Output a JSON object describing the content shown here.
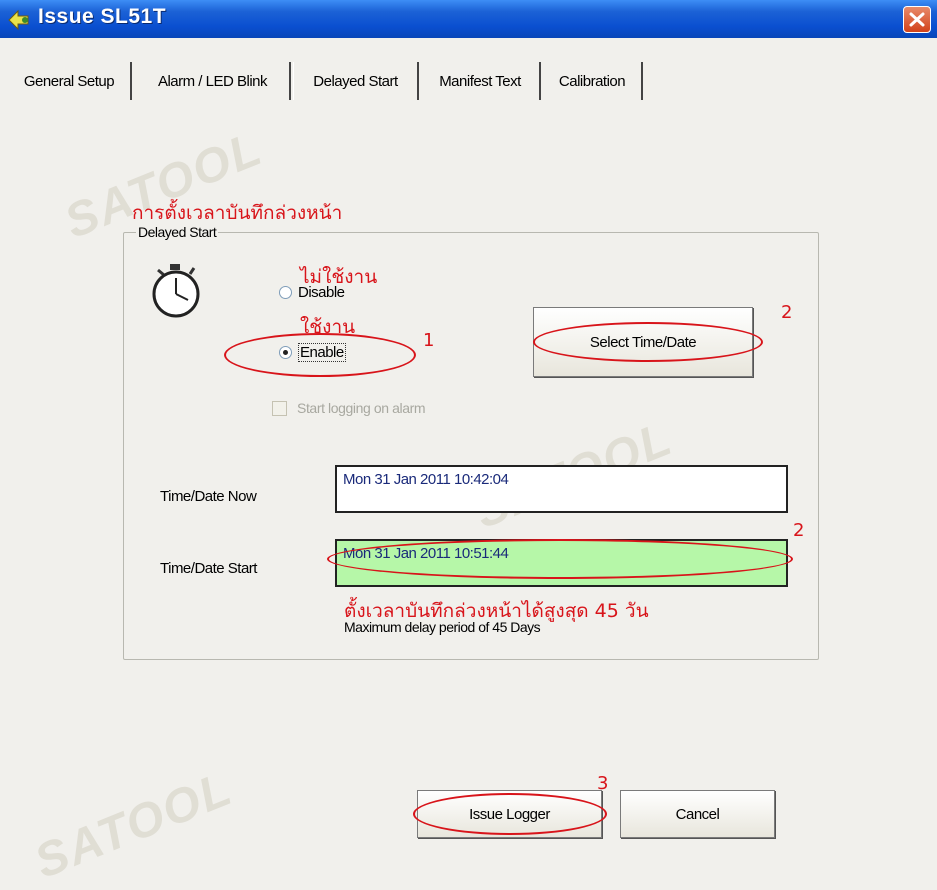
{
  "window": {
    "title": "Issue  SL51T",
    "close_icon": "close-icon",
    "app_icon": "logger-icon"
  },
  "tabs": [
    {
      "label": "General Setup",
      "active": false
    },
    {
      "label": "Alarm / LED Blink",
      "active": false
    },
    {
      "label": "Delayed Start",
      "active": true
    },
    {
      "label": "Manifest Text",
      "active": false
    },
    {
      "label": "Calibration",
      "active": false
    }
  ],
  "delayed_start": {
    "group_title": "Delayed Start",
    "group_title_thai": "การตั้งเวลาบันทึกล่วงหน้า",
    "stopwatch_icon": "stopwatch-icon",
    "disable_label": "Disable",
    "disable_thai": "ไม่ใช้งาน",
    "enable_label": "Enable",
    "enable_thai": "ใช้งาน",
    "selected": "Enable",
    "start_on_alarm_label": "Start logging on alarm",
    "select_button": "Select Time/Date",
    "now_label": "Time/Date Now",
    "now_value": "Mon 31 Jan 2011  10:42:04",
    "start_label": "Time/Date Start",
    "start_value": "Mon 31 Jan 2011  10:51:44",
    "max_note_thai": "ตั้งเวลาบันทึกล่วงหน้าได้สูงสุด 45 วัน",
    "max_note": "Maximum delay period of 45 Days"
  },
  "annotations": {
    "step1": "1",
    "step2a": "2",
    "step2b": "2",
    "step3": "3"
  },
  "footer": {
    "issue_button": "Issue Logger",
    "cancel_button": "Cancel"
  },
  "colors": {
    "title_bar": "#0a4fd0",
    "highlight": "#d8141a",
    "start_field_bg": "#b6f7a8",
    "value_text": "#1a2a7a"
  }
}
